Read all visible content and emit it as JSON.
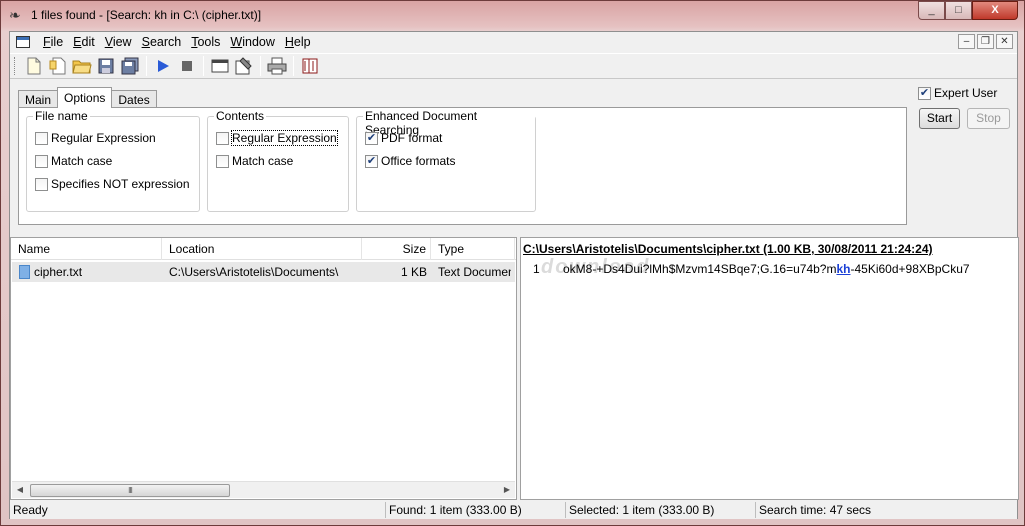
{
  "window": {
    "title": "1 files found - [Search: kh in C:\\ (cipher.txt)]",
    "minimize_glyph": "_",
    "maximize_glyph": "□",
    "close_glyph": "X"
  },
  "menu": [
    {
      "label": "File",
      "accel": "F",
      "rest": "ile"
    },
    {
      "label": "Edit",
      "accel": "E",
      "rest": "dit"
    },
    {
      "label": "View",
      "accel": "V",
      "rest": "iew"
    },
    {
      "label": "Search",
      "accel": "S",
      "rest": "earch"
    },
    {
      "label": "Tools",
      "accel": "T",
      "rest": "ools"
    },
    {
      "label": "Window",
      "accel": "W",
      "rest": "indow"
    },
    {
      "label": "Help",
      "accel": "H",
      "rest": "elp"
    }
  ],
  "toolbar": {
    "icons": [
      "new-icon",
      "new-from-template-icon",
      "open-folder-icon",
      "save-icon",
      "save-all-icon",
      "run-icon",
      "stop-icon",
      "window-icon",
      "properties-icon",
      "print-icon",
      "book-icon"
    ]
  },
  "tabs": [
    "Main",
    "Options",
    "Dates"
  ],
  "active_tab": "Options",
  "options": {
    "file_name": {
      "title": "File name",
      "items": [
        {
          "label": "Regular Expression",
          "checked": false
        },
        {
          "label": "Match case",
          "checked": false
        },
        {
          "label": "Specifies NOT expression",
          "checked": false
        }
      ]
    },
    "contents": {
      "title": "Contents",
      "items": [
        {
          "label": "Regular Expression",
          "checked": false
        },
        {
          "label": "Match case",
          "checked": false
        }
      ]
    },
    "enhanced": {
      "title": "Enhanced Document Searching",
      "items": [
        {
          "label": "PDF format",
          "checked": true
        },
        {
          "label": "Office formats",
          "checked": true
        }
      ]
    }
  },
  "expert_user": {
    "label": "Expert User",
    "checked": true
  },
  "buttons": {
    "start": "Start",
    "stop": "Stop"
  },
  "list": {
    "columns": [
      "Name",
      "Location",
      "Size",
      "Type"
    ],
    "rows": [
      {
        "name": "cipher.txt",
        "location": "C:\\Users\\Aristotelis\\Documents\\",
        "size": "1 KB",
        "type": "Text Document"
      }
    ],
    "scroll_thumb_glyph": "III"
  },
  "preview": {
    "header": "C:\\Users\\Aristotelis\\Documents\\cipher.txt  (1.00 KB,  30/08/2011 21:24:24)",
    "line_number": "1",
    "text_before": "okM8-+Ds4Dui?lMh$Mzvm14SBqe7;G.16=u74b?m",
    "match": "kh",
    "text_after": "-45Ki60d+98XBpCku7",
    "watermark": "download"
  },
  "status": {
    "ready": "Ready",
    "found": "Found: 1 item (333.00 B)",
    "selected": "Selected: 1 item (333.00 B)",
    "time": "Search time: 47 secs"
  }
}
